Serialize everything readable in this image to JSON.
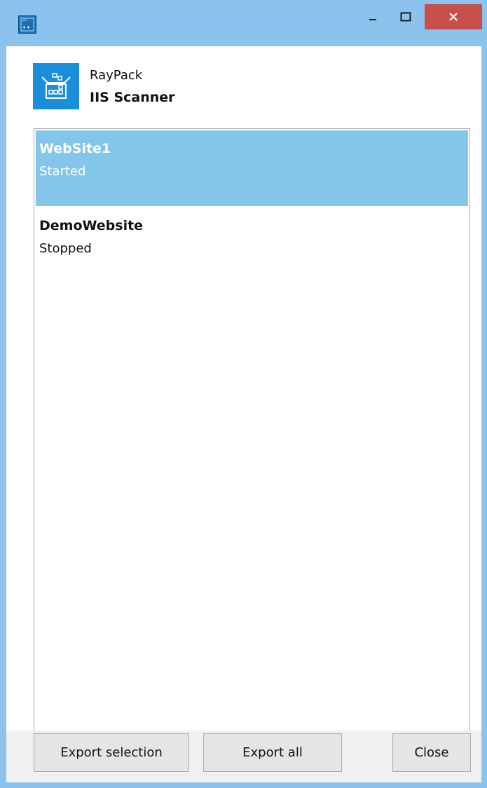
{
  "window": {
    "title_icon": "app-icon",
    "controls": {
      "minimize": "minimize-icon",
      "maximize": "maximize-icon",
      "close": "close-icon"
    }
  },
  "header": {
    "product": "RayPack",
    "tool": "IIS Scanner",
    "logo": "iis-server-icon"
  },
  "websites": [
    {
      "name": "WebSite1",
      "status": "Started",
      "selected": true
    },
    {
      "name": "DemoWebsite",
      "status": "Stopped",
      "selected": false
    }
  ],
  "buttons": {
    "export_selection": "Export selection",
    "export_all": "Export all",
    "close": "Close"
  },
  "colors": {
    "titlebar": "#8cc3ec",
    "selection": "#84c5ea",
    "close_button": "#c7504b",
    "logo_bg": "#1a8ed8"
  }
}
